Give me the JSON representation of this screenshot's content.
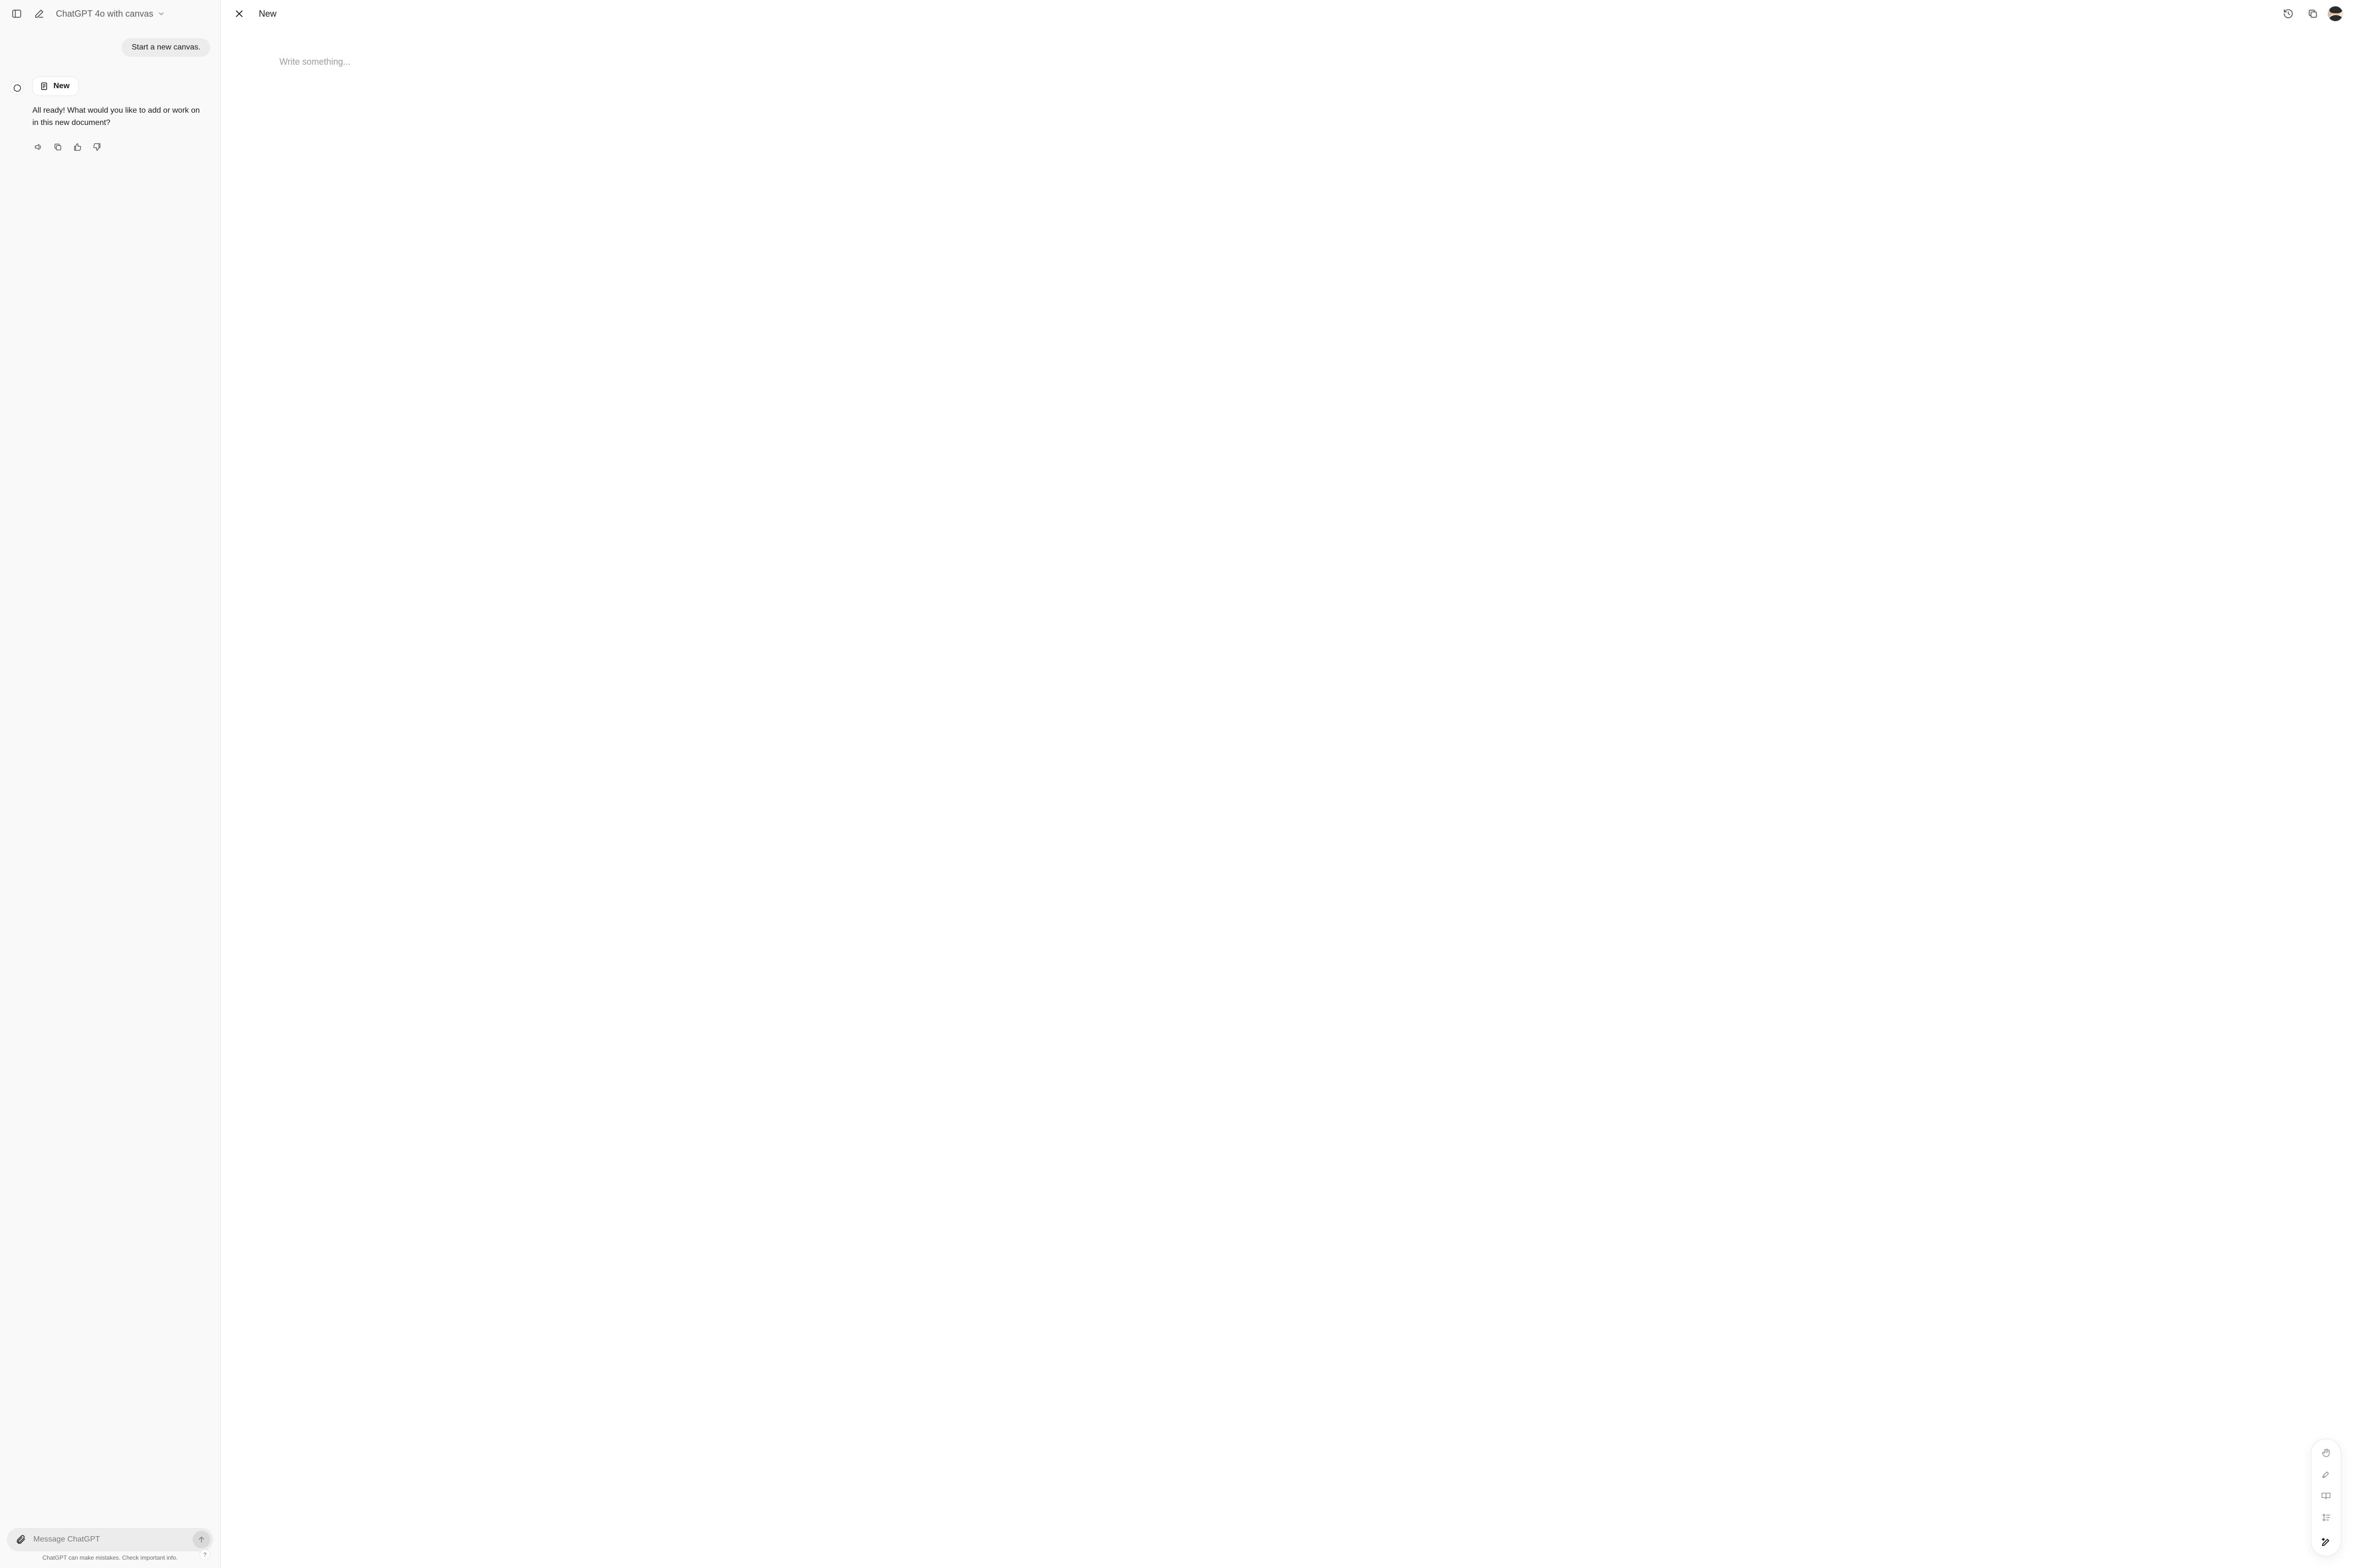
{
  "header": {
    "model_label": "ChatGPT 4o with canvas"
  },
  "chat": {
    "user_message": "Start a new canvas.",
    "doc_chip_label": "New",
    "assistant_message": "All ready! What would you like to add or work on in this new document?"
  },
  "composer": {
    "placeholder": "Message ChatGPT"
  },
  "footer": {
    "disclaimer": "ChatGPT can make mistakes. Check important info.",
    "help": "?"
  },
  "canvas": {
    "title": "New",
    "placeholder": "Write something..."
  }
}
